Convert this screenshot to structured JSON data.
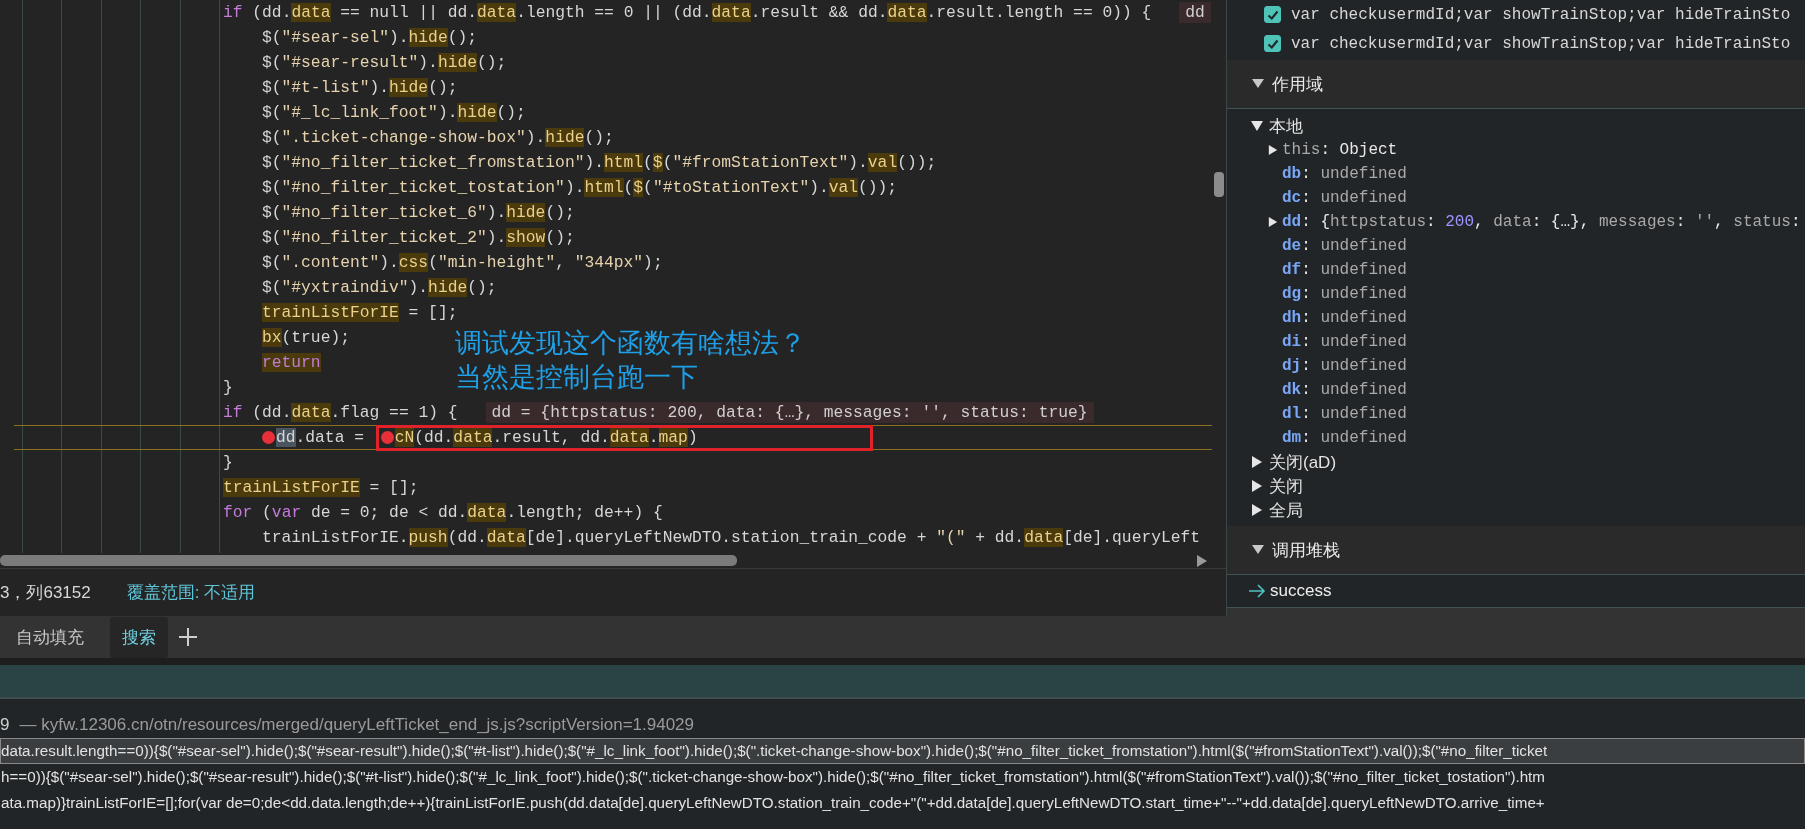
{
  "editor": {
    "lines": [
      {
        "tokens": [
          {
            "t": "if",
            "kind": "k"
          },
          {
            "t": " (dd.",
            "kind": "p"
          },
          {
            "t": "data",
            "kind": "h"
          },
          {
            "t": " == null || dd.",
            "kind": "p"
          },
          {
            "t": "data",
            "kind": "h"
          },
          {
            "t": ".length == 0 || (dd.",
            "kind": "p"
          },
          {
            "t": "data",
            "kind": "h"
          },
          {
            "t": ".result && dd.",
            "kind": "p"
          },
          {
            "t": "data",
            "kind": "h"
          },
          {
            "t": ".result.length == 0)) {",
            "kind": "p"
          }
        ],
        "inline": "dd",
        "children": [
          {
            "tokens": [
              {
                "t": "$(",
                "kind": "p"
              },
              {
                "t": "\"#sear-sel\"",
                "kind": "s"
              },
              {
                "t": ").",
                "kind": "p"
              },
              {
                "t": "hide",
                "kind": "h"
              },
              {
                "t": "();",
                "kind": "p"
              }
            ]
          },
          {
            "tokens": [
              {
                "t": "$(",
                "kind": "p"
              },
              {
                "t": "\"#sear-result\"",
                "kind": "s"
              },
              {
                "t": ").",
                "kind": "p"
              },
              {
                "t": "hide",
                "kind": "h"
              },
              {
                "t": "();",
                "kind": "p"
              }
            ]
          },
          {
            "tokens": [
              {
                "t": "$(",
                "kind": "p"
              },
              {
                "t": "\"#t-list\"",
                "kind": "s"
              },
              {
                "t": ").",
                "kind": "p"
              },
              {
                "t": "hide",
                "kind": "h"
              },
              {
                "t": "();",
                "kind": "p"
              }
            ]
          },
          {
            "tokens": [
              {
                "t": "$(",
                "kind": "p"
              },
              {
                "t": "\"#_lc_link_foot\"",
                "kind": "s"
              },
              {
                "t": ").",
                "kind": "p"
              },
              {
                "t": "hide",
                "kind": "h"
              },
              {
                "t": "();",
                "kind": "p"
              }
            ]
          },
          {
            "tokens": [
              {
                "t": "$(",
                "kind": "p"
              },
              {
                "t": "\".ticket-change-show-box\"",
                "kind": "s"
              },
              {
                "t": ").",
                "kind": "p"
              },
              {
                "t": "hide",
                "kind": "h"
              },
              {
                "t": "();",
                "kind": "p"
              }
            ]
          },
          {
            "tokens": [
              {
                "t": "$(",
                "kind": "p"
              },
              {
                "t": "\"#no_filter_ticket_fromstation\"",
                "kind": "s"
              },
              {
                "t": ").",
                "kind": "p"
              },
              {
                "t": "html",
                "kind": "h"
              },
              {
                "t": "(",
                "kind": "p"
              },
              {
                "t": "$",
                "kind": "h"
              },
              {
                "t": "(",
                "kind": "p"
              },
              {
                "t": "\"#fromStationText\"",
                "kind": "s"
              },
              {
                "t": ").",
                "kind": "p"
              },
              {
                "t": "val",
                "kind": "h"
              },
              {
                "t": "());",
                "kind": "p"
              }
            ]
          },
          {
            "tokens": [
              {
                "t": "$(",
                "kind": "p"
              },
              {
                "t": "\"#no_filter_ticket_tostation\"",
                "kind": "s"
              },
              {
                "t": ").",
                "kind": "p"
              },
              {
                "t": "html",
                "kind": "h"
              },
              {
                "t": "(",
                "kind": "p"
              },
              {
                "t": "$",
                "kind": "h"
              },
              {
                "t": "(",
                "kind": "p"
              },
              {
                "t": "\"#toStationText\"",
                "kind": "s"
              },
              {
                "t": ").",
                "kind": "p"
              },
              {
                "t": "val",
                "kind": "h"
              },
              {
                "t": "());",
                "kind": "p"
              }
            ]
          },
          {
            "tokens": [
              {
                "t": "$(",
                "kind": "p"
              },
              {
                "t": "\"#no_filter_ticket_6\"",
                "kind": "s"
              },
              {
                "t": ").",
                "kind": "p"
              },
              {
                "t": "hide",
                "kind": "h"
              },
              {
                "t": "();",
                "kind": "p"
              }
            ]
          },
          {
            "tokens": [
              {
                "t": "$(",
                "kind": "p"
              },
              {
                "t": "\"#no_filter_ticket_2\"",
                "kind": "s"
              },
              {
                "t": ").",
                "kind": "p"
              },
              {
                "t": "show",
                "kind": "h"
              },
              {
                "t": "();",
                "kind": "p"
              }
            ]
          },
          {
            "tokens": [
              {
                "t": "$(",
                "kind": "p"
              },
              {
                "t": "\".content\"",
                "kind": "s"
              },
              {
                "t": ").",
                "kind": "p"
              },
              {
                "t": "css",
                "kind": "h"
              },
              {
                "t": "(",
                "kind": "p"
              },
              {
                "t": "\"min-height\"",
                "kind": "s"
              },
              {
                "t": ", ",
                "kind": "p"
              },
              {
                "t": "\"344px\"",
                "kind": "s"
              },
              {
                "t": ");",
                "kind": "p"
              }
            ]
          },
          {
            "tokens": [
              {
                "t": "$(",
                "kind": "p"
              },
              {
                "t": "\"#yxtraindiv\"",
                "kind": "s"
              },
              {
                "t": ").",
                "kind": "p"
              },
              {
                "t": "hide",
                "kind": "h"
              },
              {
                "t": "();",
                "kind": "p"
              }
            ]
          },
          {
            "tokens": [
              {
                "t": "trainListForIE",
                "kind": "h"
              },
              {
                "t": " = [];",
                "kind": "p"
              }
            ]
          },
          {
            "tokens": [
              {
                "t": "bx",
                "kind": "h"
              },
              {
                "t": "(true);",
                "kind": "p"
              }
            ]
          },
          {
            "tokens": [
              {
                "t": "return",
                "kind": "hk"
              }
            ]
          }
        ]
      },
      {
        "tokens": [
          {
            "t": "}",
            "kind": "p"
          }
        ]
      },
      {
        "tokens": [
          {
            "t": "if",
            "kind": "k"
          },
          {
            "t": " (dd.",
            "kind": "p"
          },
          {
            "t": "data",
            "kind": "h"
          },
          {
            "t": ".flag == 1) {",
            "kind": "p"
          }
        ],
        "inline": "dd = {httpstatus: 200, data: {…}, messages: '', status: true}",
        "children": [
          {
            "current": true,
            "tokens": [
              {
                "t": "dd",
                "kind": "sel",
                "bp": true
              },
              {
                "t": ".data = ",
                "kind": "p"
              }
            ],
            "boxed_tokens": [
              {
                "t": "cN",
                "kind": "h",
                "bp": true
              },
              {
                "t": "(dd.",
                "kind": "p"
              },
              {
                "t": "data",
                "kind": "h"
              },
              {
                "t": ".result, dd.",
                "kind": "p"
              },
              {
                "t": "data",
                "kind": "h"
              },
              {
                "t": ".",
                "kind": "p"
              },
              {
                "t": "map",
                "kind": "h"
              },
              {
                "t": ")",
                "kind": "p"
              }
            ]
          }
        ]
      },
      {
        "tokens": [
          {
            "t": "}",
            "kind": "p"
          }
        ]
      },
      {
        "tokens": [
          {
            "t": "trainListForIE",
            "kind": "h"
          },
          {
            "t": " = [];",
            "kind": "p"
          }
        ]
      },
      {
        "tokens": [
          {
            "t": "for",
            "kind": "k"
          },
          {
            "t": " (",
            "kind": "p"
          },
          {
            "t": "var",
            "kind": "k"
          },
          {
            "t": " de = 0; de < dd.",
            "kind": "p"
          },
          {
            "t": "data",
            "kind": "h"
          },
          {
            "t": ".length; de++) {",
            "kind": "p"
          }
        ],
        "children": [
          {
            "tokens": [
              {
                "t": "trainListForIE.",
                "kind": "p"
              },
              {
                "t": "push",
                "kind": "h"
              },
              {
                "t": "(dd.",
                "kind": "p"
              },
              {
                "t": "data",
                "kind": "h"
              },
              {
                "t": "[de].queryLeftNewDTO.station_train_code + ",
                "kind": "p"
              },
              {
                "t": "\"(\"",
                "kind": "s"
              },
              {
                "t": " + dd.",
                "kind": "p"
              },
              {
                "t": "data",
                "kind": "h"
              },
              {
                "t": "[de].queryLeft",
                "kind": "p"
              }
            ]
          }
        ]
      }
    ]
  },
  "annotation": {
    "lines": [
      "调试发现这个函数有啥想法？",
      "当然是控制台跑一下"
    ]
  },
  "status_bar": {
    "position": "3，列63152",
    "coverage": "覆盖范围: 不适用"
  },
  "sidebar": {
    "watch": [
      {
        "expression": "var checkusermdId;var showTrainStop;var hideTrainSto",
        "checked": true
      },
      {
        "expression": "var checkusermdId;var showTrainStop;var hideTrainSto",
        "checked": true
      }
    ],
    "scope": {
      "title": "作用域",
      "expanded": true,
      "items": [
        {
          "label": "本地",
          "expanded": true,
          "children": [
            {
              "kind": "this",
              "name": "this",
              "expanded": false,
              "value": [
                {
                  "t": ": ",
                  "kind": "w"
                },
                {
                  "t": "Object",
                  "kind": "w"
                }
              ]
            },
            {
              "kind": "var",
              "name": "db",
              "value": [
                {
                  "t": ": ",
                  "kind": "w"
                },
                {
                  "t": "undefined",
                  "kind": "g"
                }
              ]
            },
            {
              "kind": "var",
              "name": "dc",
              "value": [
                {
                  "t": ": ",
                  "kind": "w"
                },
                {
                  "t": "undefined",
                  "kind": "g"
                }
              ]
            },
            {
              "kind": "var",
              "name": "dd",
              "expanded": false,
              "value": [
                {
                  "t": ": {",
                  "kind": "w"
                },
                {
                  "t": "httpstatus",
                  "kind": "g"
                },
                {
                  "t": ": ",
                  "kind": "w"
                },
                {
                  "t": "200",
                  "kind": "n"
                },
                {
                  "t": ", ",
                  "kind": "w"
                },
                {
                  "t": "data",
                  "kind": "g"
                },
                {
                  "t": ": {…}, ",
                  "kind": "w"
                },
                {
                  "t": "messages",
                  "kind": "g"
                },
                {
                  "t": ": ",
                  "kind": "w"
                },
                {
                  "t": "''",
                  "kind": "g"
                },
                {
                  "t": ", ",
                  "kind": "w"
                },
                {
                  "t": "status",
                  "kind": "g"
                },
                {
                  "t": ":",
                  "kind": "w"
                }
              ]
            },
            {
              "kind": "var",
              "name": "de",
              "value": [
                {
                  "t": ": ",
                  "kind": "w"
                },
                {
                  "t": "undefined",
                  "kind": "g"
                }
              ]
            },
            {
              "kind": "var",
              "name": "df",
              "value": [
                {
                  "t": ": ",
                  "kind": "w"
                },
                {
                  "t": "undefined",
                  "kind": "g"
                }
              ]
            },
            {
              "kind": "var",
              "name": "dg",
              "value": [
                {
                  "t": ": ",
                  "kind": "w"
                },
                {
                  "t": "undefined",
                  "kind": "g"
                }
              ]
            },
            {
              "kind": "var",
              "name": "dh",
              "value": [
                {
                  "t": ": ",
                  "kind": "w"
                },
                {
                  "t": "undefined",
                  "kind": "g"
                }
              ]
            },
            {
              "kind": "var",
              "name": "di",
              "value": [
                {
                  "t": ": ",
                  "kind": "w"
                },
                {
                  "t": "undefined",
                  "kind": "g"
                }
              ]
            },
            {
              "kind": "var",
              "name": "dj",
              "value": [
                {
                  "t": ": ",
                  "kind": "w"
                },
                {
                  "t": "undefined",
                  "kind": "g"
                }
              ]
            },
            {
              "kind": "var",
              "name": "dk",
              "value": [
                {
                  "t": ": ",
                  "kind": "w"
                },
                {
                  "t": "undefined",
                  "kind": "g"
                }
              ]
            },
            {
              "kind": "var",
              "name": "dl",
              "value": [
                {
                  "t": ": ",
                  "kind": "w"
                },
                {
                  "t": "undefined",
                  "kind": "g"
                }
              ]
            },
            {
              "kind": "var",
              "name": "dm",
              "value": [
                {
                  "t": ": ",
                  "kind": "w"
                },
                {
                  "t": "undefined",
                  "kind": "g"
                }
              ]
            }
          ]
        },
        {
          "label": "关闭(aD)",
          "expanded": false
        },
        {
          "label": "关闭",
          "expanded": false
        },
        {
          "label": "全局",
          "expanded": false
        }
      ]
    },
    "call_stack": {
      "title": "调用堆栈",
      "expanded": true,
      "frames": [
        {
          "name": "success",
          "current": true
        }
      ]
    }
  },
  "drawer": {
    "tabs": [
      {
        "label": "自动填充",
        "selected": false
      },
      {
        "label": "搜索",
        "selected": true
      }
    ],
    "results": {
      "line": "9",
      "file": "— kyfw.12306.cn/otn/resources/merged/queryLeftTicket_end_js.js?scriptVersion=1.94029",
      "matches": [
        {
          "text": "data.result.length==0)){$(\"#sear-sel\").hide();$(\"#sear-result\").hide();$(\"#t-list\").hide();$(\"#_lc_link_foot\").hide();$(\".ticket-change-show-box\").hide();$(\"#no_filter_ticket_fromstation\").html($(\"#fromStationText\").val());$(\"#no_filter_ticket",
          "selected": true
        },
        {
          "text": "h==0)){$(\"#sear-sel\").hide();$(\"#sear-result\").hide();$(\"#t-list\").hide();$(\"#_lc_link_foot\").hide();$(\".ticket-change-show-box\").hide();$(\"#no_filter_ticket_fromstation\").html($(\"#fromStationText\").val());$(\"#no_filter_ticket_tostation\").htm",
          "selected": false
        },
        {
          "text": "ata.map)}trainListForIE=[];for(var de=0;de<dd.data.length;de++){trainListForIE.push(dd.data[de].queryLeftNewDTO.station_train_code+\"(\"+dd.data[de].queryLeftNewDTO.start_time+\"--\"+dd.data[de].queryLeftNewDTO.arrive_time+",
          "selected": false
        }
      ]
    }
  }
}
